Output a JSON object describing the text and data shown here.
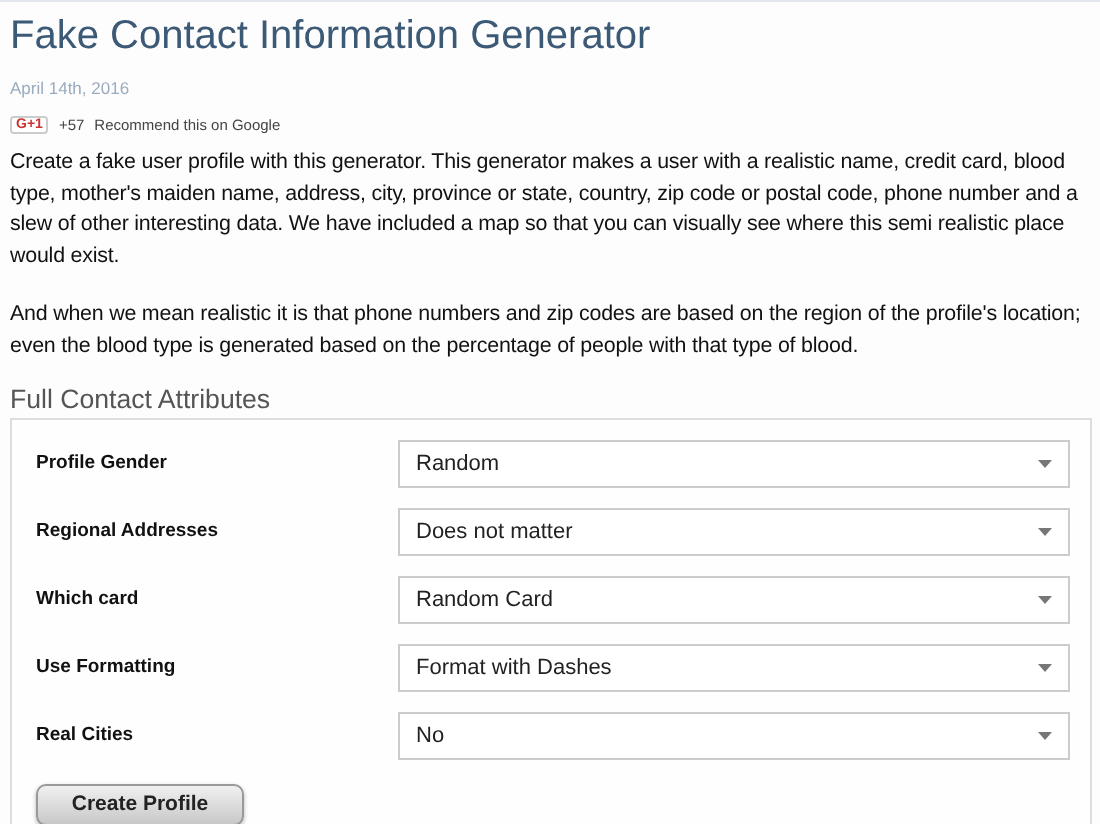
{
  "title": "Fake Contact Information Generator",
  "date": "April 14th, 2016",
  "social": {
    "button": "G+1",
    "count": "+57",
    "label": "Recommend this on Google"
  },
  "paragraphs": [
    "Create a fake user profile with this generator. This generator makes a user with a realistic name, credit card, blood type, mother's maiden name, address, city, province or state, country, zip code or postal code, phone number and a slew of other interesting data. We have included a map so that you can visually see where this semi realistic place would exist.",
    "And when we mean realistic it is that phone numbers and zip codes are based on the region of the profile's location; even the blood type is generated based on the percentage of people with that type of blood."
  ],
  "section_title": "Full Contact Attributes",
  "fields": [
    {
      "label": "Profile Gender",
      "value": "Random"
    },
    {
      "label": "Regional Addresses",
      "value": "Does not matter"
    },
    {
      "label": "Which card",
      "value": "Random Card"
    },
    {
      "label": "Use Formatting",
      "value": "Format with Dashes"
    },
    {
      "label": "Real Cities",
      "value": "No"
    }
  ],
  "submit": "Create Profile"
}
